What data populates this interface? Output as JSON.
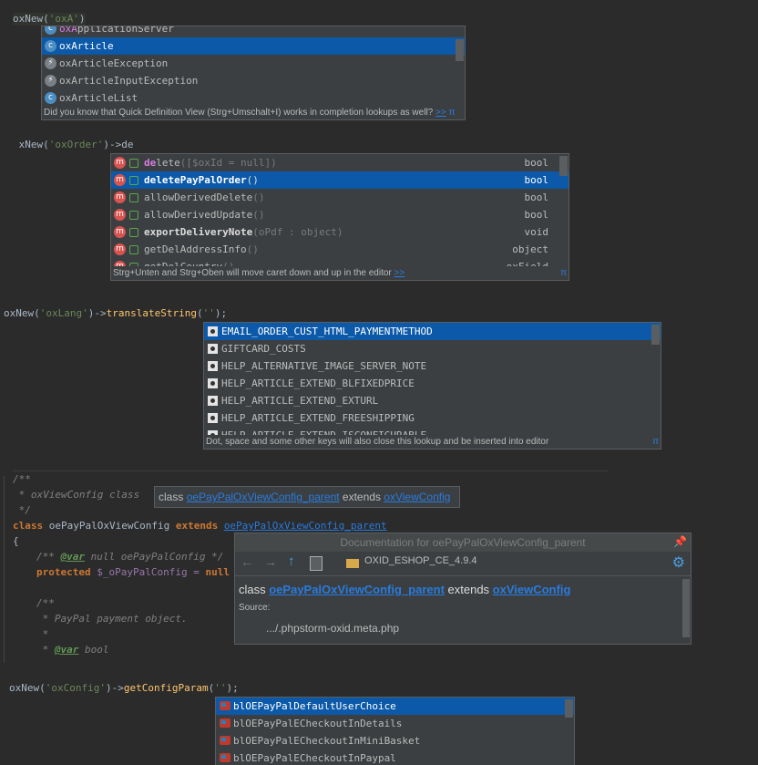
{
  "section1": {
    "code_prefix": "oxNew(",
    "code_string": "'oxA'",
    "code_suffix": ")",
    "items": [
      {
        "name": "oxApplicationServer",
        "icon": "c"
      },
      {
        "name": "oxArticle",
        "icon": "c"
      },
      {
        "name": "oxArticleException",
        "icon": "e"
      },
      {
        "name": "oxArticleInputException",
        "icon": "e"
      },
      {
        "name": "oxArticleList",
        "icon": "c"
      }
    ],
    "footer": "Did you know that Quick Definition View (Strg+Umschalt+I) works in completion lookups as well?",
    "footer_link": ">>",
    "pi": "π"
  },
  "section2": {
    "code_prefix": " xNew(",
    "code_string": "'oxOrder'",
    "code_suffix": ")->de",
    "items": [
      {
        "match": "de",
        "rest": "lete",
        "params": "([$oxId = null])",
        "type": "bool"
      },
      {
        "match": "de",
        "rest": "letePayPalOrder",
        "params": "()",
        "type": "bool"
      },
      {
        "match": "",
        "rest": "allowDerivedDelete",
        "params": "()",
        "type": "bool"
      },
      {
        "match": "",
        "rest": "allowDerivedUpdate",
        "params": "()",
        "type": "bool"
      },
      {
        "match": "",
        "rest": "exportDeliveryNote",
        "params": "(oPdf : object)",
        "type": "void"
      },
      {
        "match": "",
        "rest": "getDelAddressInfo",
        "params": "()",
        "type": "object"
      },
      {
        "match": "",
        "rest": "getDelCountry",
        "params": "()",
        "type": "oxField"
      }
    ],
    "footer": "Strg+Unten and Strg+Oben will move caret down and up in the editor",
    "footer_link": ">>",
    "pi": "π"
  },
  "section3": {
    "code_prefix": "oxNew(",
    "code_string": "'oxLang'",
    "code_mid": ")->",
    "code_fn": "translateString",
    "code_paren": "(",
    "code_arg": "''",
    "code_end": ");",
    "items": [
      "EMAIL_ORDER_CUST_HTML_PAYMENTMETHOD",
      "GIFTCARD_COSTS",
      "HELP_ALTERNATIVE_IMAGE_SERVER_NOTE",
      "HELP_ARTICLE_EXTEND_BLFIXEDPRICE",
      "HELP_ARTICLE_EXTEND_EXTURL",
      "HELP_ARTICLE_EXTEND_FREESHIPPING",
      "HELP_ARTICLE_EXTEND_ISCONFIGURABLE"
    ],
    "footer": "Dot, space and some other keys will also close this lookup and be inserted into editor",
    "pi": "π"
  },
  "section4": {
    "c1": "/**",
    "c2": " * oxViewConfig class",
    "c3": " */",
    "class_kw": "class",
    "class_name": " oePayPalOxViewConfig ",
    "extends_kw": "extends",
    "parent": "oePayPalOxViewConfig_parent",
    "brace": "{",
    "var_doc_pre": "/** ",
    "var_tag": "@var",
    "var_doc_post": " null oePayPalConfig */",
    "protected_kw": "protected",
    "prop": " $_oPayPalConfig = ",
    "null_kw": "null",
    "d1": "/**",
    "d2": " * PayPal payment object.",
    "d3": " *",
    "d4_pre": " * ",
    "d4_tag": "@var",
    "d4_post": " bool",
    "tooltip_class": "class ",
    "tooltip_parent": "oePayPalOxViewConfig_parent",
    "tooltip_extends": " extends ",
    "tooltip_base": "oxViewConfig",
    "doc_title": "Documentation for oePayPalOxViewConfig_parent",
    "doc_module": "OXID_ESHOP_CE_4.9.4",
    "doc_class": "class ",
    "doc_parent": "oePayPalOxViewConfig_parent",
    "doc_extends": " extends ",
    "doc_base": "oxViewConfig",
    "doc_source_label": "Source:",
    "doc_source": ".../.phpstorm-oxid.meta.php"
  },
  "section5": {
    "code_prefix": "oxNew(",
    "code_string": "'oxConfig'",
    "code_mid": ")->",
    "code_fn": "getConfigParam",
    "code_paren": "(",
    "code_arg": "''",
    "code_end": ");",
    "items": [
      "blOEPayPalDefaultUserChoice",
      "blOEPayPalECheckoutInDetails",
      "blOEPayPalECheckoutInMiniBasket",
      "blOEPayPalECheckoutInPaypal"
    ]
  }
}
